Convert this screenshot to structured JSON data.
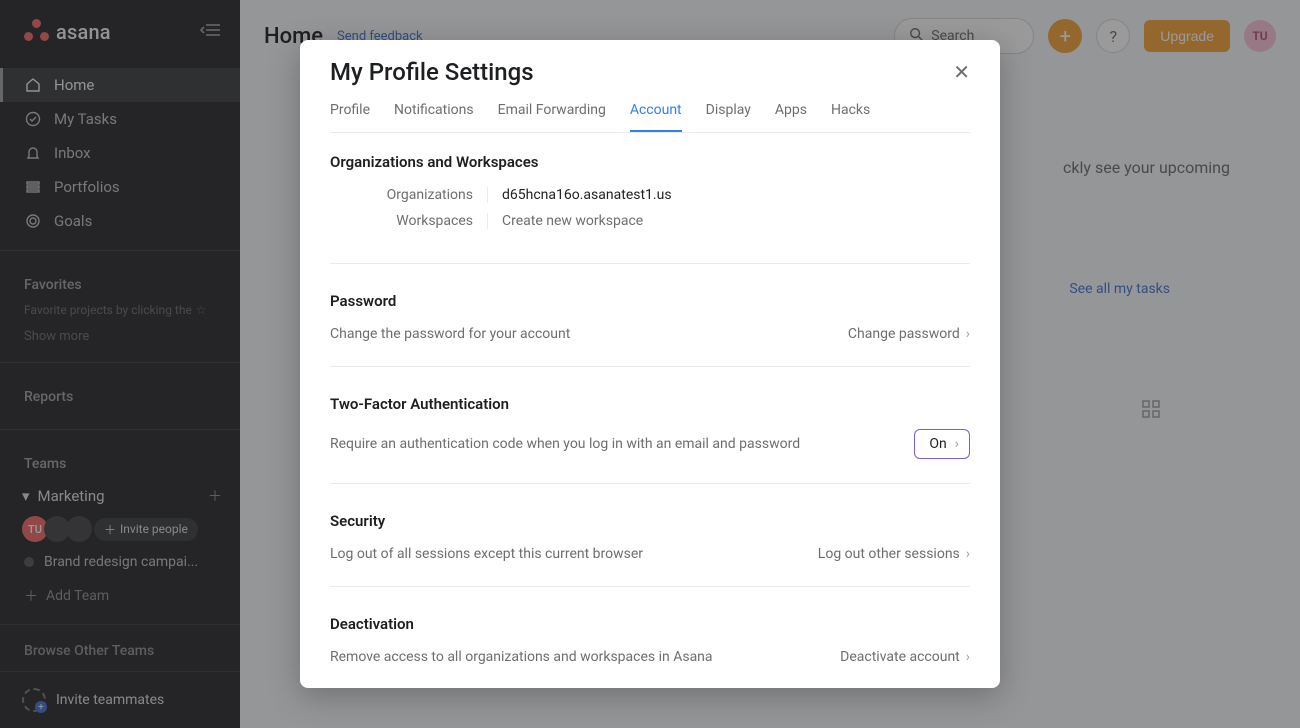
{
  "brand": {
    "name": "asana"
  },
  "sidebar": {
    "nav": [
      {
        "label": "Home",
        "icon": "home"
      },
      {
        "label": "My Tasks",
        "icon": "check-circle"
      },
      {
        "label": "Inbox",
        "icon": "bell"
      },
      {
        "label": "Portfolios",
        "icon": "bars"
      },
      {
        "label": "Goals",
        "icon": "target"
      }
    ],
    "favorites_header": "Favorites",
    "favorites_hint": "Favorite projects by clicking the",
    "show_more": "Show more",
    "reports_header": "Reports",
    "teams_header": "Teams",
    "team_name": "Marketing",
    "member_initials": "TU",
    "invite_people": "Invite people",
    "project": "Brand redesign campai...",
    "add_team": "Add Team",
    "browse_other": "Browse Other Teams",
    "invite_teammates": "Invite teammates"
  },
  "header": {
    "page_title": "Home",
    "feedback": "Send feedback",
    "search_placeholder": "Search",
    "upgrade": "Upgrade",
    "avatar": "TU",
    "body_hint": "ckly see your upcoming",
    "see_all": "See all my tasks"
  },
  "modal": {
    "title": "My Profile Settings",
    "tabs": [
      "Profile",
      "Notifications",
      "Email Forwarding",
      "Account",
      "Display",
      "Apps",
      "Hacks"
    ],
    "active_tab": "Account",
    "org_section_title": "Organizations and Workspaces",
    "org_label": "Organizations",
    "org_value": "d65hcna16o.asanatest1.us",
    "workspaces_label": "Workspaces",
    "create_workspace": "Create new workspace",
    "password_title": "Password",
    "password_text": "Change the password for your account",
    "password_action": "Change password",
    "tfa_title": "Two-Factor Authentication",
    "tfa_text": "Require an authentication code when you log in with an email and password",
    "tfa_state": "On",
    "security_title": "Security",
    "security_text": "Log out of all sessions except this current browser",
    "security_action": "Log out other sessions",
    "deact_title": "Deactivation",
    "deact_text": "Remove access to all organizations and workspaces in Asana",
    "deact_action": "Deactivate account"
  }
}
